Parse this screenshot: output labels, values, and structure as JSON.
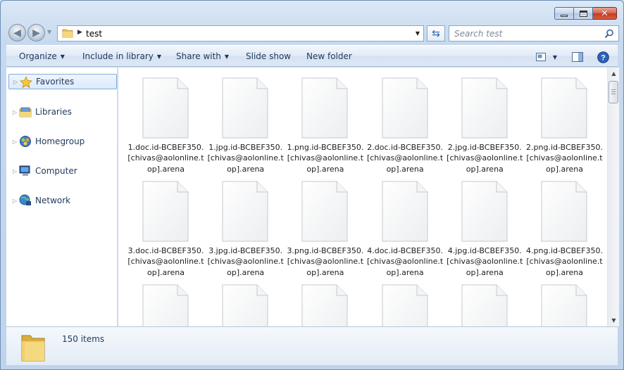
{
  "window": {
    "title": "test"
  },
  "address": {
    "path": "test"
  },
  "search": {
    "placeholder": "Search test"
  },
  "toolbar": {
    "organize": "Organize",
    "include": "Include in library",
    "share": "Share with",
    "slideshow": "Slide show",
    "newfolder": "New folder"
  },
  "nav": {
    "items": [
      {
        "label": "Favorites",
        "icon": "star-icon"
      },
      {
        "label": "Libraries",
        "icon": "libraries-icon"
      },
      {
        "label": "Homegroup",
        "icon": "homegroup-icon"
      },
      {
        "label": "Computer",
        "icon": "computer-icon"
      },
      {
        "label": "Network",
        "icon": "network-icon"
      }
    ]
  },
  "files": [
    "1.doc.id-BCBEF350.[chivas@aolonline.top].arena",
    "1.jpg.id-BCBEF350.[chivas@aolonline.top].arena",
    "1.png.id-BCBEF350.[chivas@aolonline.top].arena",
    "2.doc.id-BCBEF350.[chivas@aolonline.top].arena",
    "2.jpg.id-BCBEF350.[chivas@aolonline.top].arena",
    "2.png.id-BCBEF350.[chivas@aolonline.top].arena",
    "3.doc.id-BCBEF350.[chivas@aolonline.top].arena",
    "3.jpg.id-BCBEF350.[chivas@aolonline.top].arena",
    "3.png.id-BCBEF350.[chivas@aolonline.top].arena",
    "4.doc.id-BCBEF350.[chivas@aolonline.top].arena",
    "4.jpg.id-BCBEF350.[chivas@aolonline.top].arena",
    "4.png.id-BCBEF350.[chivas@aolonline.top].arena"
  ],
  "status": {
    "count": "150 items"
  },
  "colors": {
    "accent": "#1e395b",
    "selection_border": "#84acdd",
    "close_button": "#c43c22"
  }
}
